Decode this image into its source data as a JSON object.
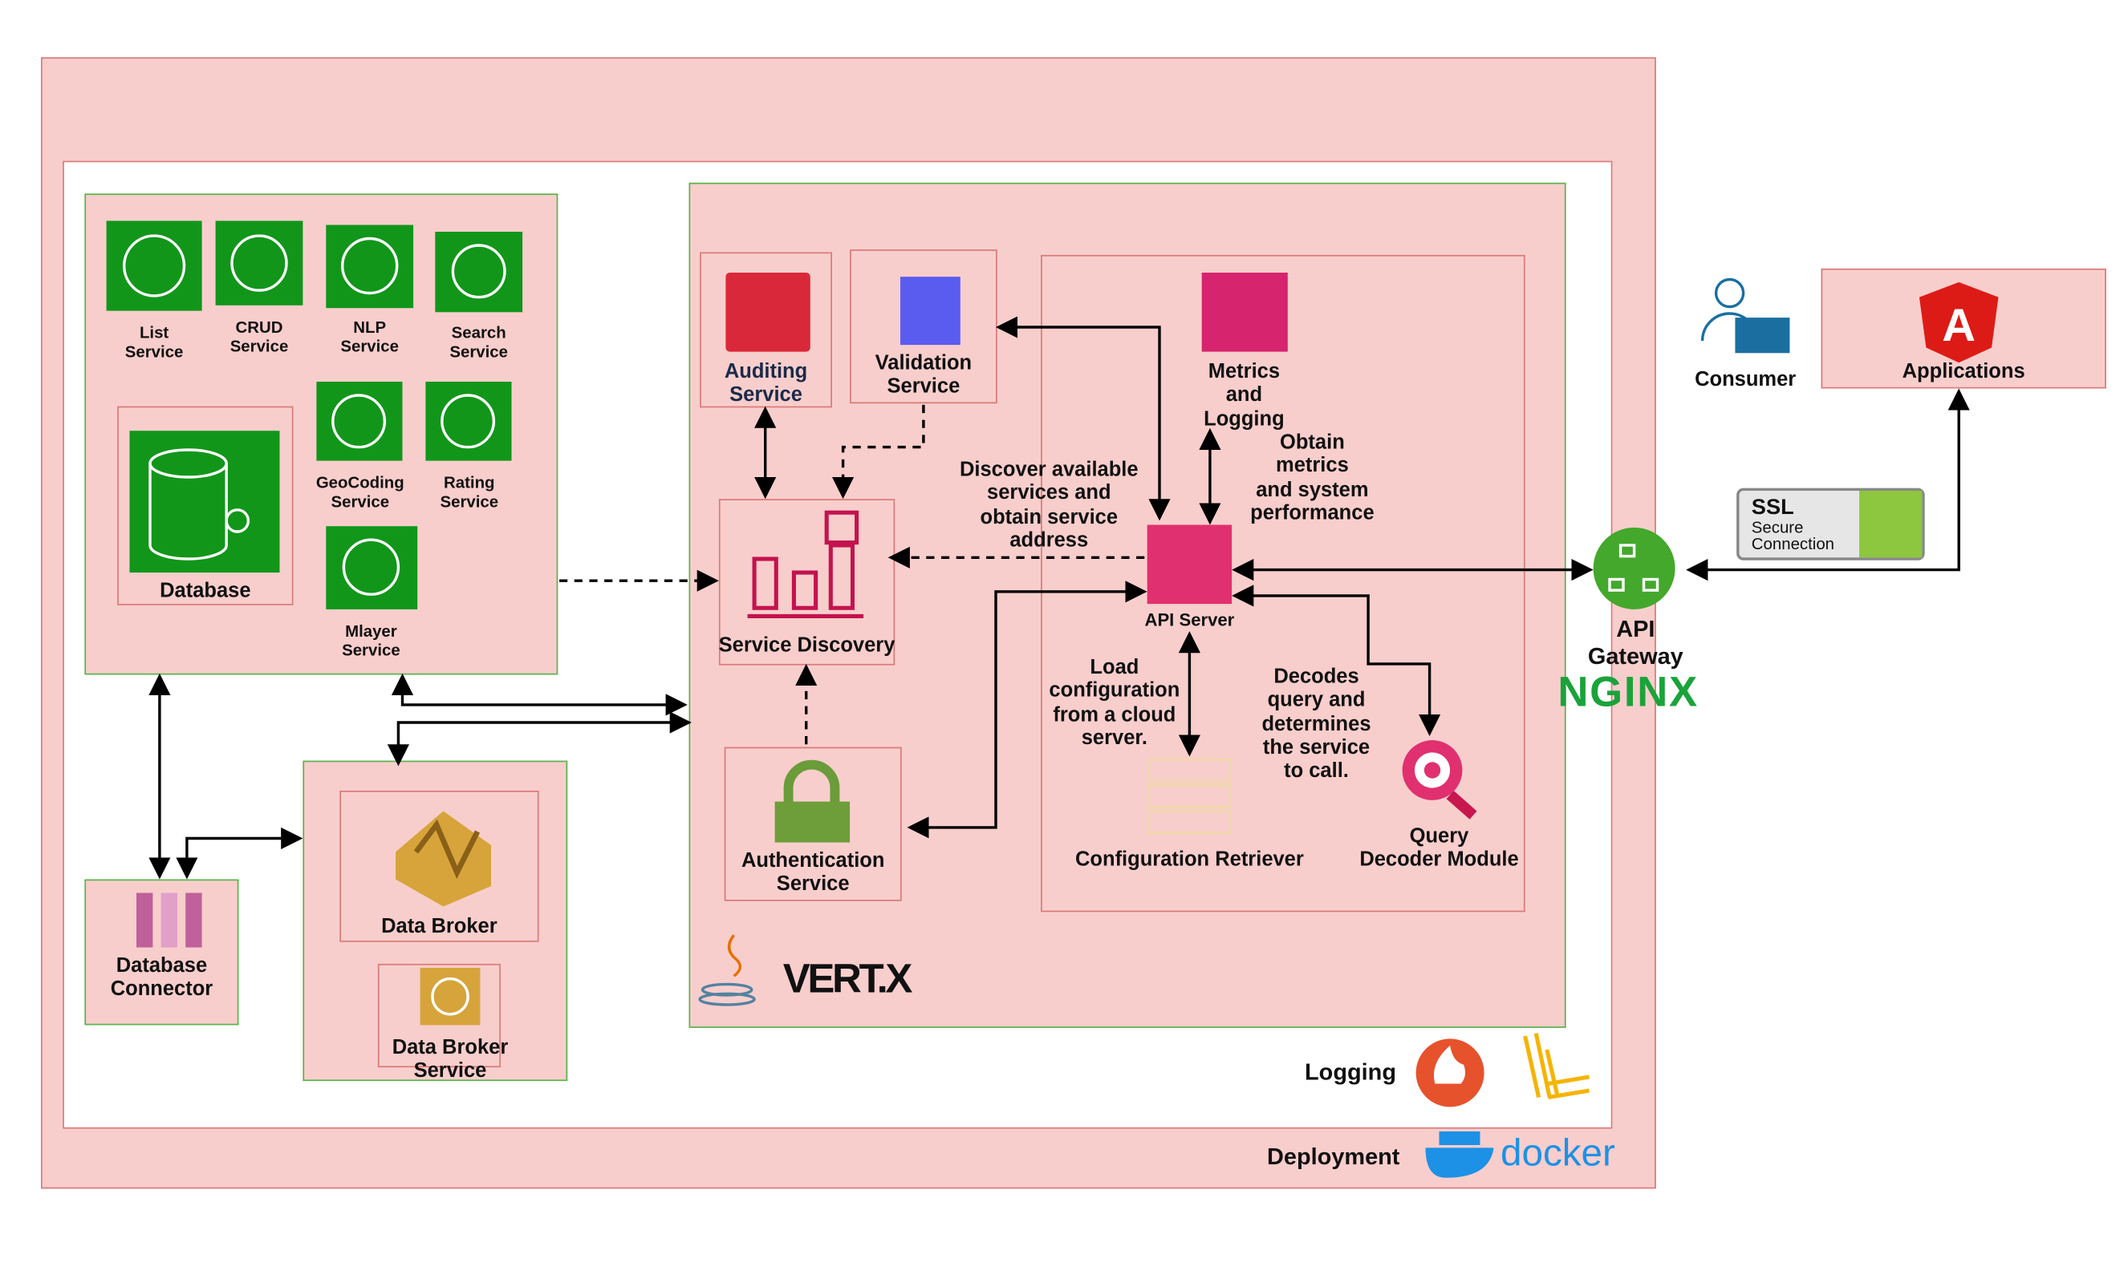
{
  "deployment": {
    "label": "Deployment",
    "logo": "docker"
  },
  "logging": {
    "label": "Logging"
  },
  "microservices": {
    "items": [
      {
        "label": "List\nService"
      },
      {
        "label": "CRUD\nService"
      },
      {
        "label": "NLP\nService"
      },
      {
        "label": "Search\nService"
      },
      {
        "label": "GeoCoding\nService"
      },
      {
        "label": "Rating\nService"
      },
      {
        "label": "Mlayer\nService"
      }
    ],
    "database": "Database"
  },
  "database_connector": "Database\nConnector",
  "data_broker": {
    "label": "Data Broker",
    "service": "Data Broker\nService"
  },
  "vertx": {
    "logo_text": "VERT.X",
    "auditing": "Auditing\nService",
    "validation": "Validation\nService",
    "service_discovery": "Service Discovery",
    "authentication": "Authentication\nService",
    "metrics": "Metrics\nand\nLogging",
    "api_server": "API Server",
    "config_retriever": "Configuration Retriever",
    "query_decoder": "Query\nDecoder Module",
    "note_discover": "Discover available\nservices and\nobtain service\naddress",
    "note_metrics": "Obtain\nmetrics\nand system\nperformance",
    "note_config": "Load\nconfiguration\nfrom a cloud\nserver.",
    "note_decode": "Decodes\nquery and\ndetermines\nthe service\nto call."
  },
  "gateway": {
    "label": "API\nGateway",
    "logo": "NGINX"
  },
  "consumer": "Consumer",
  "applications": "Applications",
  "ssl": {
    "title": "SSL",
    "subtitle": "Secure\nConnection"
  },
  "colors": {
    "container": "#f8cecc",
    "border_red": "#d97a78",
    "border_green": "#58b44a",
    "service_green": "#11961a"
  }
}
